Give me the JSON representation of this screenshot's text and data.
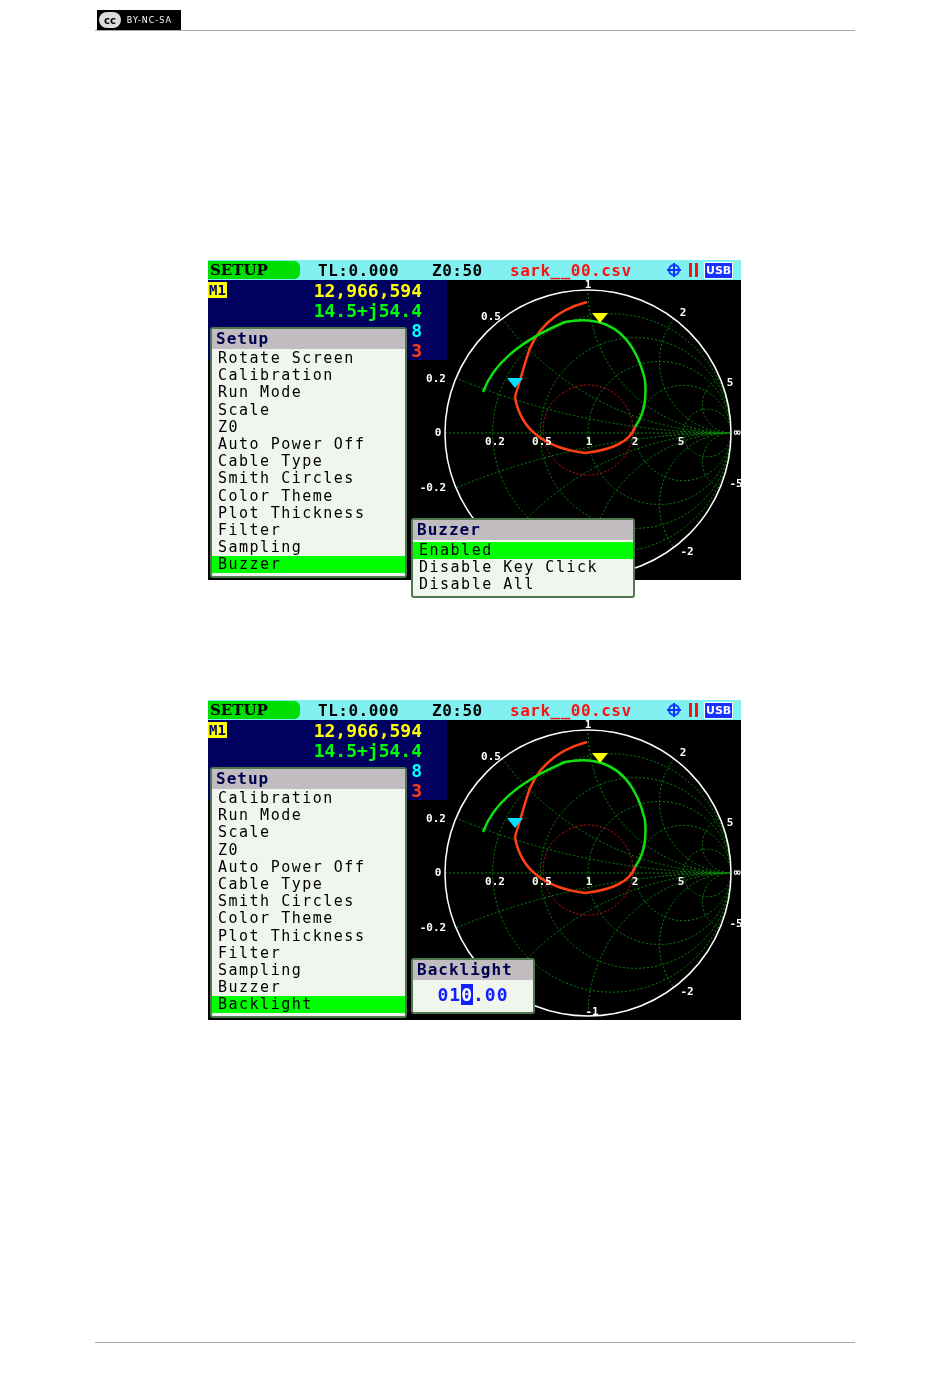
{
  "license_badge": {
    "logo": "cc",
    "text": "BY-NC-SA"
  },
  "screens": [
    {
      "status": {
        "mode": "SETUP",
        "tl": "TL:0.000",
        "z0": "Z0:50",
        "file": "sark__00.csv",
        "usb": "USB"
      },
      "info": [
        {
          "label": "M1",
          "value": "12,966,594",
          "color": "#ffff00"
        },
        {
          "value": "14.5+j54.4",
          "color": "#00ff00"
        },
        {
          "value": "8",
          "color": "#00ffff"
        },
        {
          "value": "3",
          "color": "#ff4010"
        }
      ],
      "chart_labels": [
        "1",
        "0.5",
        "2",
        "0.2",
        "5",
        "0",
        "0.2",
        "0.5",
        "1",
        "2",
        "5",
        "∞",
        "-0.2",
        "-5",
        "-2"
      ],
      "menu": {
        "title": "Setup",
        "items": [
          {
            "label": "Rotate Screen",
            "selected": false
          },
          {
            "label": "Calibration",
            "selected": false
          },
          {
            "label": "Run Mode",
            "selected": false
          },
          {
            "label": "Scale",
            "selected": false
          },
          {
            "label": "Z0",
            "selected": false
          },
          {
            "label": "Auto Power Off",
            "selected": false
          },
          {
            "label": "Cable Type",
            "selected": false
          },
          {
            "label": "Smith Circles",
            "selected": false
          },
          {
            "label": "Color Theme",
            "selected": false
          },
          {
            "label": "Plot Thickness",
            "selected": false
          },
          {
            "label": "Filter",
            "selected": false
          },
          {
            "label": "Sampling",
            "selected": false
          },
          {
            "label": "Buzzer",
            "selected": true
          }
        ]
      },
      "submenu": {
        "kind": "list",
        "title": "Buzzer",
        "items": [
          {
            "label": "Enabled",
            "selected": true
          },
          {
            "label": "Disable Key Click",
            "selected": false
          },
          {
            "label": "Disable All",
            "selected": false
          }
        ]
      }
    },
    {
      "status": {
        "mode": "SETUP",
        "tl": "TL:0.000",
        "z0": "Z0:50",
        "file": "sark__00.csv",
        "usb": "USB"
      },
      "info": [
        {
          "label": "M1",
          "value": "12,966,594",
          "color": "#ffff00"
        },
        {
          "value": "14.5+j54.4",
          "color": "#00ff00"
        },
        {
          "value": "8",
          "color": "#00ffff"
        },
        {
          "value": "3",
          "color": "#ff4010"
        }
      ],
      "chart_labels": [
        "1",
        "0.5",
        "2",
        "0.2",
        "5",
        "0",
        "0.2",
        "0.5",
        "1",
        "2",
        "5",
        "∞",
        "-0.2",
        "-5",
        "-2",
        "-1"
      ],
      "menu": {
        "title": "Setup",
        "items": [
          {
            "label": "Calibration",
            "selected": false
          },
          {
            "label": "Run Mode",
            "selected": false
          },
          {
            "label": "Scale",
            "selected": false
          },
          {
            "label": "Z0",
            "selected": false
          },
          {
            "label": "Auto Power Off",
            "selected": false
          },
          {
            "label": "Cable Type",
            "selected": false
          },
          {
            "label": "Smith Circles",
            "selected": false
          },
          {
            "label": "Color Theme",
            "selected": false
          },
          {
            "label": "Plot Thickness",
            "selected": false
          },
          {
            "label": "Filter",
            "selected": false
          },
          {
            "label": "Sampling",
            "selected": false
          },
          {
            "label": "Buzzer",
            "selected": false
          },
          {
            "label": "Backlight",
            "selected": true
          }
        ]
      },
      "submenu": {
        "kind": "number",
        "title": "Backlight",
        "value_before": "01",
        "value_cursor": "0",
        "value_after": ".00"
      }
    }
  ]
}
